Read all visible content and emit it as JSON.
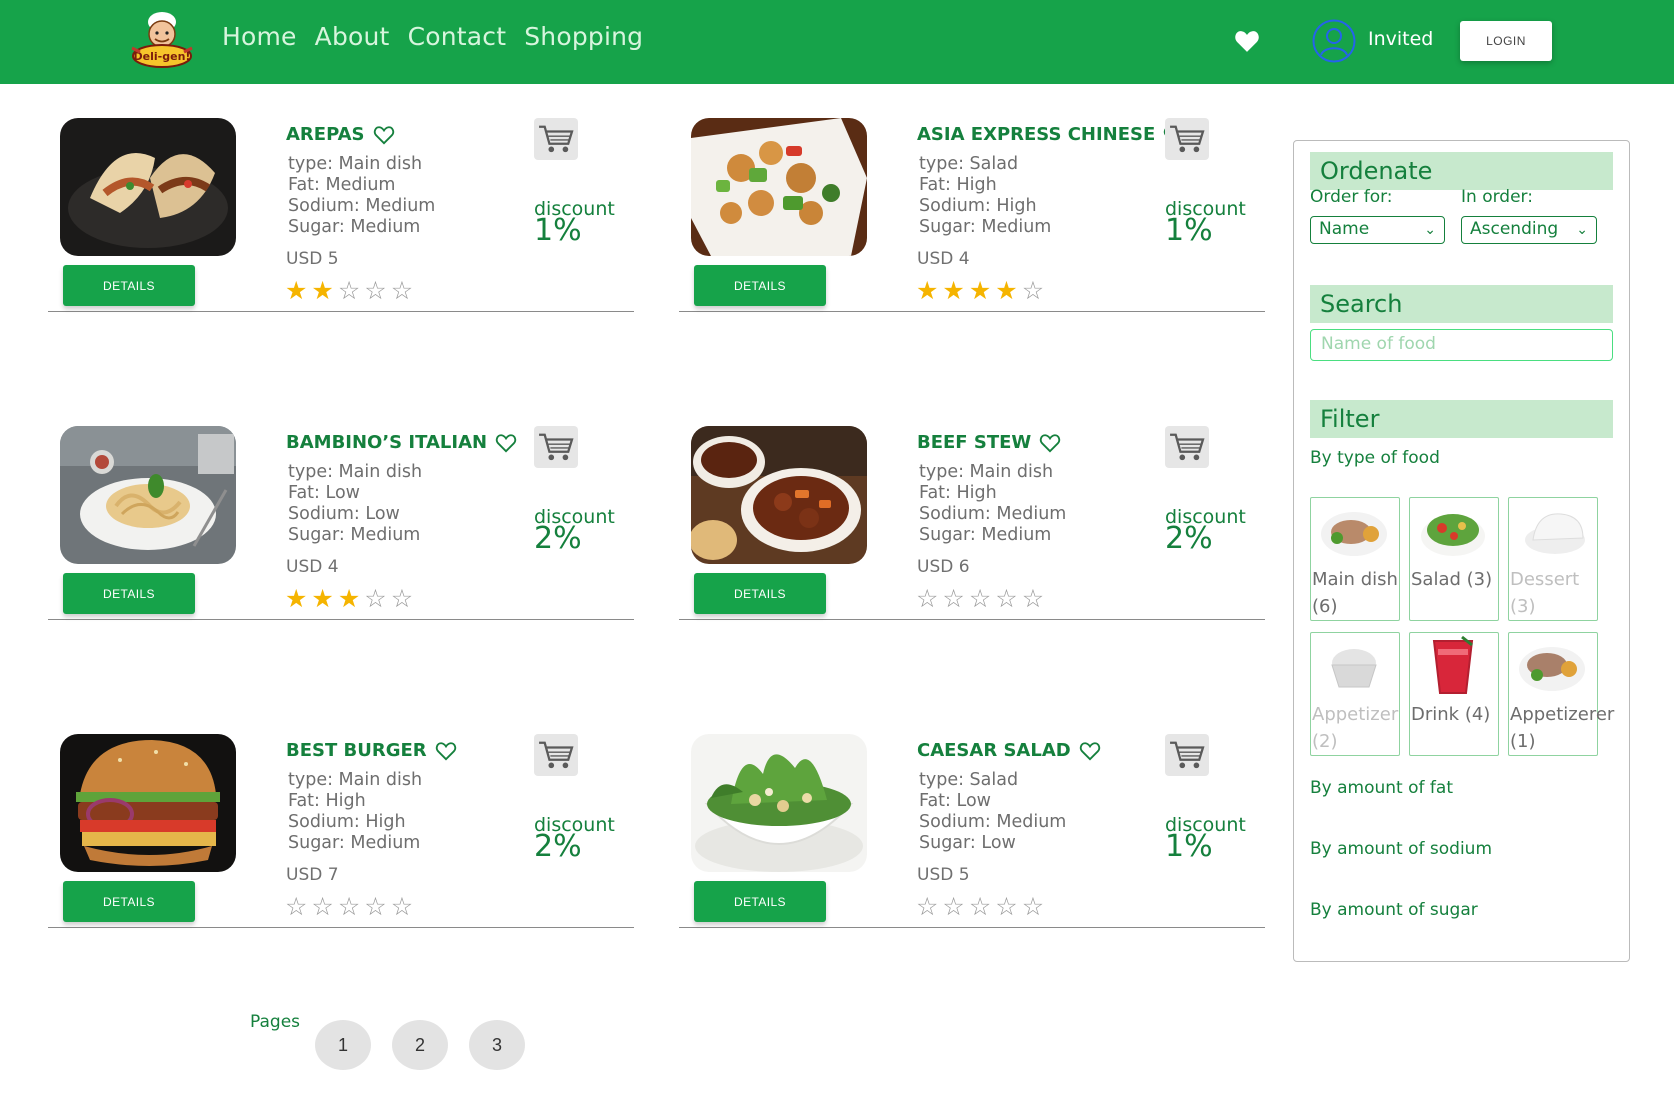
{
  "nav": {
    "logo_text": "Deli-gen!",
    "links": [
      "Home",
      "About",
      "Contact",
      "Shopping"
    ],
    "user_label": "Invited",
    "login_label": "LOGIN"
  },
  "products": [
    {
      "name": "AREPAS",
      "type": "type: Main dish",
      "fat": "Fat: Medium",
      "sodium": "Sodium: Medium",
      "sugar": "Sugar: Medium",
      "price": "USD 5",
      "rating": 2,
      "discount_label": "discount",
      "discount": "1%",
      "details_label": "DETAILS"
    },
    {
      "name": "ASIA EXPRESS CHINESE",
      "type": "type: Salad",
      "fat": "Fat: High",
      "sodium": "Sodium: High",
      "sugar": "Sugar: Medium",
      "price": "USD 4",
      "rating": 4,
      "discount_label": "discount",
      "discount": "1%",
      "details_label": "DETAILS"
    },
    {
      "name": "BAMBINO’S ITALIAN",
      "type": "type: Main dish",
      "fat": "Fat: Low",
      "sodium": "Sodium: Low",
      "sugar": "Sugar: Medium",
      "price": "USD 4",
      "rating": 3,
      "discount_label": "discount",
      "discount": "2%",
      "details_label": "DETAILS"
    },
    {
      "name": "BEEF STEW",
      "type": "type: Main dish",
      "fat": "Fat: High",
      "sodium": "Sodium: Medium",
      "sugar": "Sugar: Medium",
      "price": "USD 6",
      "rating": 0,
      "discount_label": "discount",
      "discount": "2%",
      "details_label": "DETAILS"
    },
    {
      "name": "BEST BURGER",
      "type": "type: Main dish",
      "fat": "Fat: High",
      "sodium": "Sodium: High",
      "sugar": "Sugar: Medium",
      "price": "USD 7",
      "rating": 0,
      "discount_label": "discount",
      "discount": "2%",
      "details_label": "DETAILS"
    },
    {
      "name": "CAESAR SALAD",
      "type": "type: Salad",
      "fat": "Fat: Low",
      "sodium": "Sodium: Medium",
      "sugar": "Sugar: Low",
      "price": "USD 5",
      "rating": 0,
      "discount_label": "discount",
      "discount": "1%",
      "details_label": "DETAILS"
    }
  ],
  "sidebar": {
    "ordenate_title": "Ordenate",
    "order_for_label": "Order for:",
    "order_for_value": "Name",
    "in_order_label": "In order:",
    "in_order_value": "Ascending",
    "search_title": "Search",
    "search_placeholder": "Name of food",
    "filter_title": "Filter",
    "by_type_label": "By type of food",
    "types": [
      {
        "label": "Main dish (6)",
        "active": true
      },
      {
        "label": "Salad (3)",
        "active": true
      },
      {
        "label": "Dessert (3)",
        "active": false
      },
      {
        "label": "Appetizer (2)",
        "active": false
      },
      {
        "label": "Drink (4)",
        "active": true
      },
      {
        "label": "Appetizerer (1)",
        "active": true
      }
    ],
    "by_fat_label": "By amount of fat",
    "by_sodium_label": "By amount of sodium",
    "by_sugar_label": "By amount of sugar"
  },
  "pagination": {
    "label": "Pages",
    "pages": [
      "1",
      "2",
      "3"
    ]
  },
  "colors": {
    "brand": "#16a34a",
    "brand_dark": "#15803d",
    "panel_head": "#c7e9cd",
    "star": "#f5b400"
  }
}
